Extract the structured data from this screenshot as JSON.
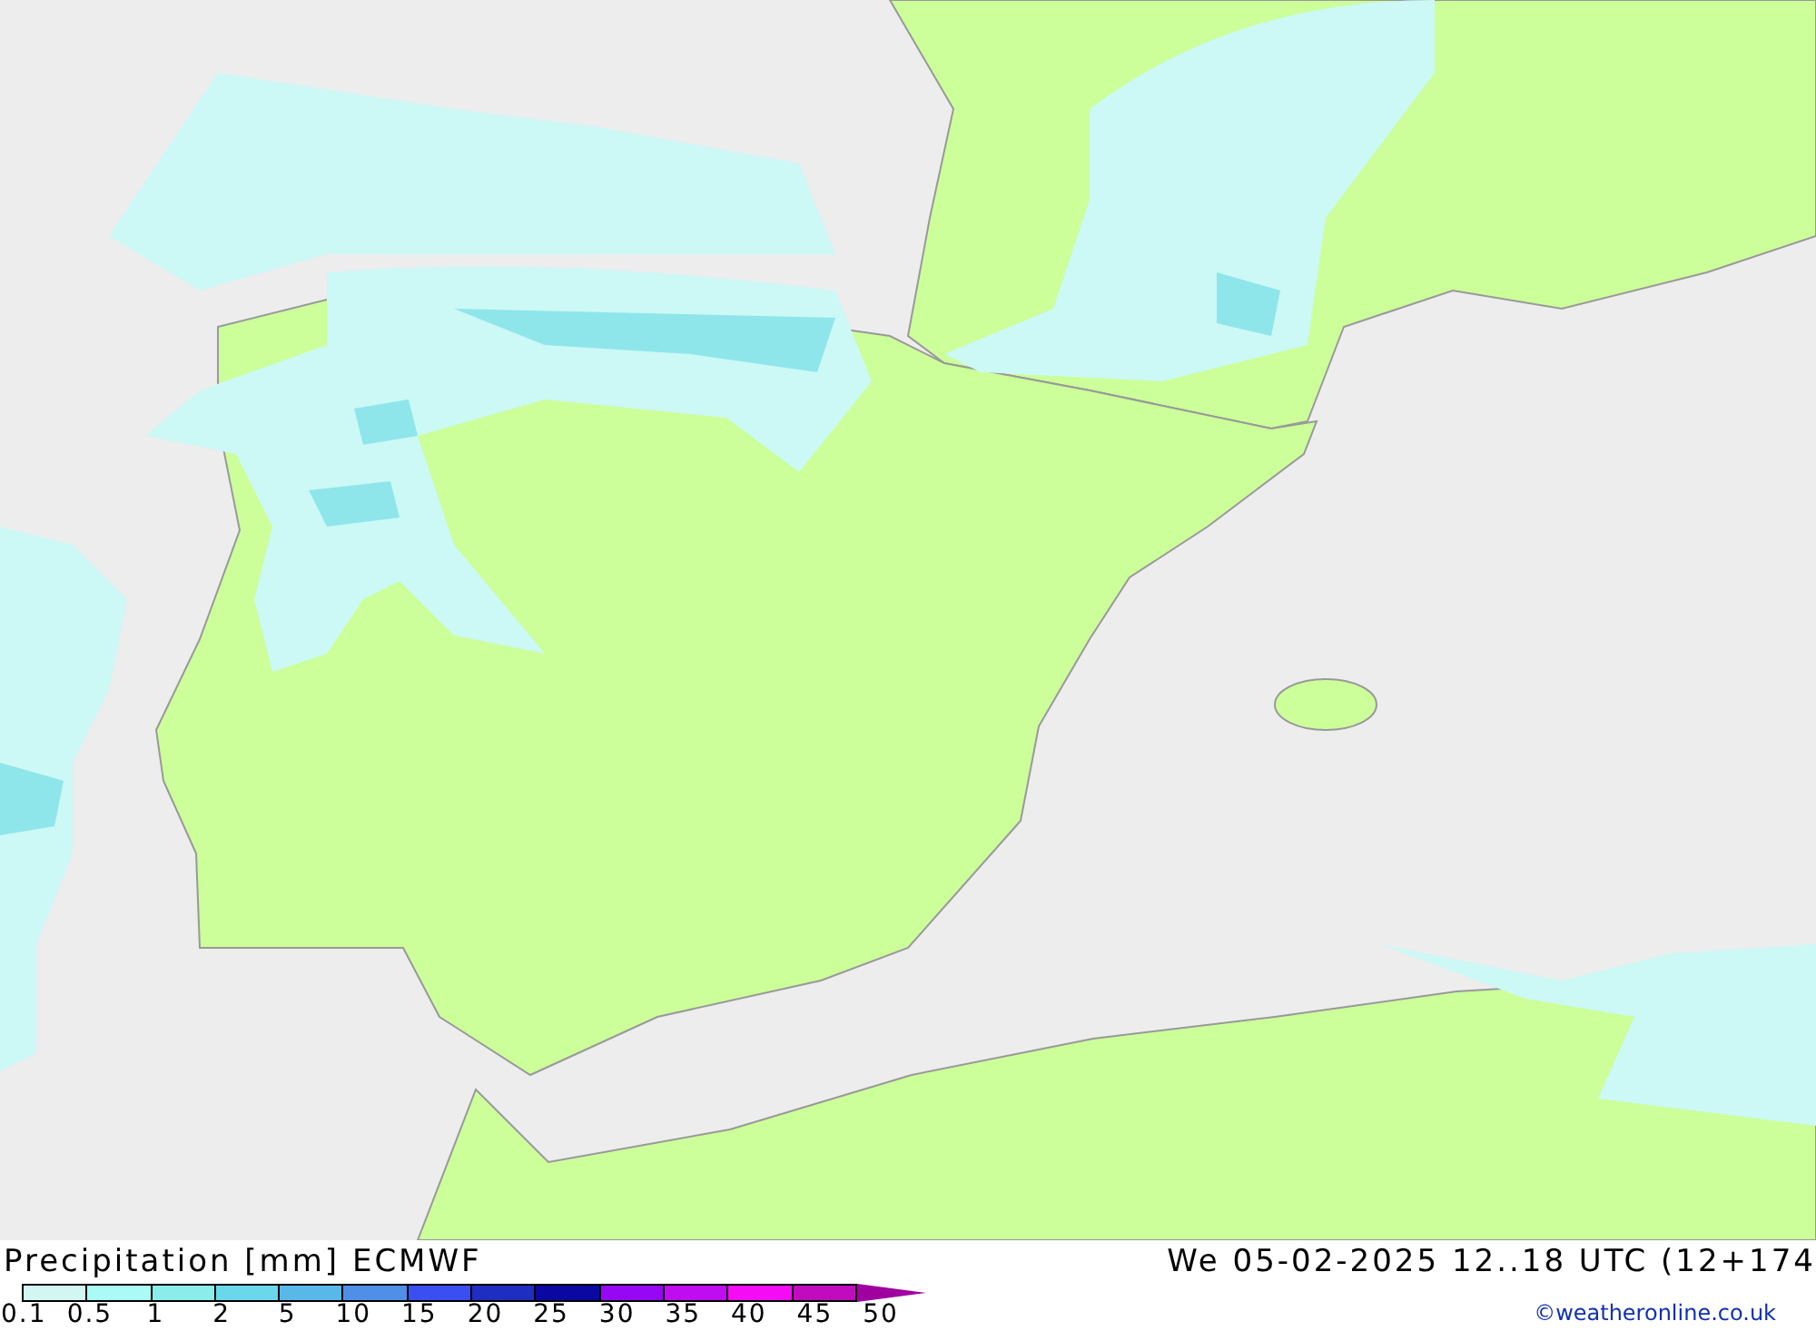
{
  "title": "Precipitation [mm]",
  "model": "ECMWF",
  "valid_time": "We 05-02-2025 12..18 UTC (12+174",
  "legend": {
    "segments": [
      {
        "color": "#d2f7f3"
      },
      {
        "color": "#aafaf6"
      },
      {
        "color": "#8aeceb"
      },
      {
        "color": "#6ad8ea"
      },
      {
        "color": "#5ab8e8"
      },
      {
        "color": "#508fe8"
      },
      {
        "color": "#3a4ff2"
      },
      {
        "color": "#1e2ec0"
      },
      {
        "color": "#0a08a0"
      },
      {
        "color": "#9608f4"
      },
      {
        "color": "#c00cf0"
      },
      {
        "color": "#f40cf4"
      },
      {
        "color": "#c00cbc"
      }
    ],
    "arrow": {
      "color": "#a000a0"
    },
    "labels": [
      "0.1",
      "0.5",
      "1",
      "2",
      "5",
      "10",
      "15",
      "20",
      "25",
      "30",
      "35",
      "40",
      "45",
      "50"
    ]
  },
  "credit": "©weatheronline.co.uk"
}
